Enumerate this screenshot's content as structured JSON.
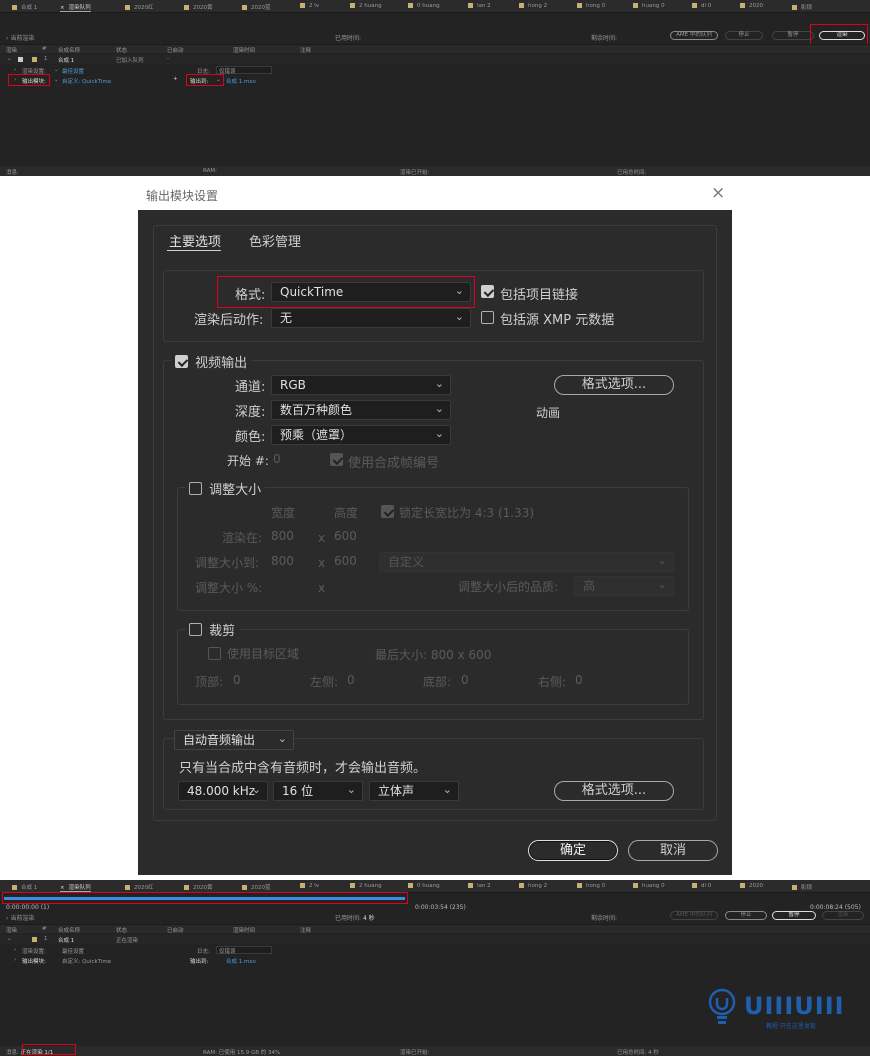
{
  "top_panel": {
    "tabs": [
      "合成 1",
      "渲染队列",
      "2020红",
      "2020黄",
      "2020蓝",
      "2 lv",
      "2 huang",
      "0 huang",
      "lan 2",
      "hong 2",
      "hong 0",
      "huang 0",
      "di 0",
      "2020",
      "影锁"
    ],
    "current_render_label": "当前渲染",
    "elapsed_label": "已用时间:",
    "remaining_label": "剩余时间:",
    "ame_queue_button": "AME 中的队列",
    "stop_button": "停止",
    "pause_button": "暂停",
    "render_button": "渲染",
    "columns": [
      "渲染",
      "#",
      "合成名称",
      "状态",
      "已启动",
      "渲染时间",
      "注释"
    ],
    "item": {
      "index": "1",
      "comp": "合成 1",
      "status": "已加入队列",
      "started": "-"
    },
    "render_settings_label": "渲染设置:",
    "render_settings_value": "最佳设置",
    "log_label": "日志:",
    "log_value": "仅错误",
    "output_module_label": "输出模块:",
    "output_module_value": "自定义: QuickTime",
    "output_to_label": "输出到:",
    "output_to_value": "合成 1.mov",
    "status_bar": [
      "消息:",
      "RAM:",
      "渲染已开始:",
      "已用总时间:"
    ]
  },
  "dialog": {
    "title": "输出模块设置",
    "close": "×",
    "tabs": [
      "主要选项",
      "色彩管理"
    ],
    "format_label": "格式:",
    "format_value": "QuickTime",
    "include_project_link": "包括项目链接",
    "post_render_label": "渲染后动作:",
    "post_render_value": "无",
    "include_xmp": "包括源 XMP 元数据",
    "video_output": "视频输出",
    "channels_label": "通道:",
    "channels_value": "RGB",
    "depth_label": "深度:",
    "depth_value": "数百万种颜色",
    "color_label": "颜色:",
    "color_value": "预乘（遮罩）",
    "format_options": "格式选项...",
    "codec_text": "动画",
    "start_label": "开始 #:",
    "start_value": "0",
    "use_comp_frame": "使用合成帧编号",
    "resize": "调整大小",
    "width_h": "宽度",
    "height_h": "高度",
    "lock_aspect": "锁定长宽比为 4:3 (1.33)",
    "render_at": "渲染在:",
    "render_w": "800",
    "x": "x",
    "render_h": "600",
    "resize_to": "调整大小到:",
    "resize_w": "800",
    "resize_h": "600",
    "resize_preset": "自定义",
    "resize_pct": "调整大小 %:",
    "resize_quality_label": "调整大小后的品质:",
    "resize_quality": "高",
    "crop": "裁剪",
    "use_region": "使用目标区域",
    "final_size": "最后大小: 800 x 600",
    "top_label": "顶部:",
    "top_val": "0",
    "left_label": "左侧:",
    "left_val": "0",
    "bottom_label": "底部:",
    "bottom_val": "0",
    "right_label": "右侧:",
    "right_val": "0",
    "audio_mode": "自动音频输出",
    "audio_note": "只有当合成中含有音频时，才会输出音频。",
    "sample_rate": "48.000 kHz",
    "bits": "16 位",
    "channels_audio": "立体声",
    "audio_format_options": "格式选项...",
    "ok": "确定",
    "cancel": "取消"
  },
  "bottom_panel": {
    "tabs": [
      "合成 1",
      "渲染队列",
      "2020红",
      "2020黄",
      "2020蓝",
      "2 lv",
      "2 huang",
      "0 huang",
      "lan 2",
      "hong 2",
      "hong 0",
      "huang 0",
      "di 0",
      "2020",
      "影锁"
    ],
    "time_start": "0:00:00:00 (1)",
    "time_mid": "0:00:03:54 (235)",
    "time_end": "0:00:08:24 (505)",
    "progress": 0.465,
    "current_render_label": "当前渲染",
    "elapsed_label": "已用时间:",
    "elapsed_value": "4 秒",
    "remaining_label": "剩余时间:",
    "ame_queue_button": "AME 中的队列",
    "stop_button": "停止",
    "pause_button": "暂停",
    "render_button": "渲染",
    "columns": [
      "渲染",
      "#",
      "合成名称",
      "状态",
      "已启动",
      "渲染时间",
      "注释"
    ],
    "item": {
      "index": "1",
      "comp": "合成 1",
      "status": "正在渲染"
    },
    "render_settings_label": "渲染设置:",
    "render_settings_value": "最佳设置",
    "log_label": "日志:",
    "log_value": "仅错误",
    "output_module_label": "输出模块:",
    "output_module_value": "自定义: QuickTime",
    "output_to_label": "输出到:",
    "output_to_value": "合成 1.mov",
    "message_label": "消息:",
    "message_value": "正在渲染 1/1",
    "ram_value": "RAM: 已使用 15.9 GB 的 34%",
    "render_started": "渲染已开始:",
    "total_time": "已用总时间: 4 秒"
  },
  "watermark": {
    "logo": "UIIIUIII",
    "tagline": "教程·只在这里发现"
  },
  "colors": {
    "accent_red": "#e0001b",
    "progress_blue": "#3a8de0",
    "link_blue": "#4a9fe0"
  }
}
